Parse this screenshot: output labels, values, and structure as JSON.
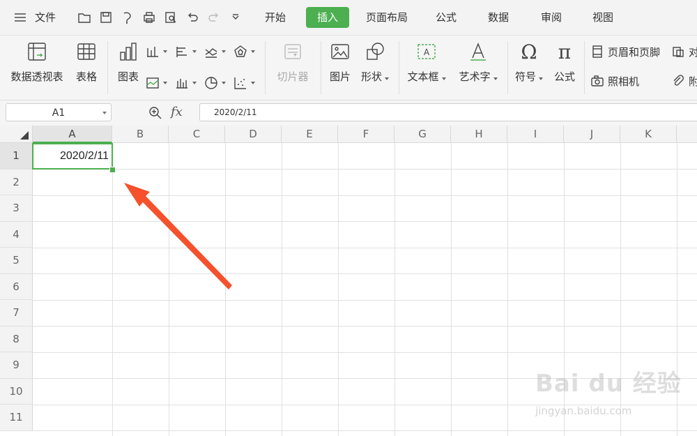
{
  "menubar": {
    "file_label": "文件",
    "tabs": [
      {
        "label": "开始"
      },
      {
        "label": "插入"
      },
      {
        "label": "页面布局"
      },
      {
        "label": "公式"
      },
      {
        "label": "数据"
      },
      {
        "label": "审阅"
      },
      {
        "label": "视图"
      }
    ],
    "active_tab": "插入",
    "accent_color": "#4caf50"
  },
  "ribbon": {
    "pivot_table": "数据透视表",
    "table": "表格",
    "chart": "图表",
    "slicer": "切片器",
    "picture": "图片",
    "shape": "形状",
    "textbox": "文本框",
    "wordart": "艺术字",
    "symbol": "符号",
    "equation": "公式",
    "header_footer": "页眉和页脚",
    "object_partial": "对",
    "camera": "照相机",
    "attachment_partial": "附"
  },
  "formula_bar": {
    "name_box": "A1",
    "fx_label": "fx",
    "value": "2020/2/11"
  },
  "grid": {
    "columns": [
      "A",
      "B",
      "C",
      "D",
      "E",
      "F",
      "G",
      "H",
      "I",
      "J",
      "K"
    ],
    "rows": [
      "1",
      "2",
      "3",
      "4",
      "5",
      "6",
      "7",
      "8",
      "9",
      "10",
      "11"
    ],
    "cell_a1": "2020/2/11",
    "selected_cell": "A1"
  },
  "watermark": {
    "brand": "Bai du 经验",
    "url": "jingyan.baidu.com"
  }
}
